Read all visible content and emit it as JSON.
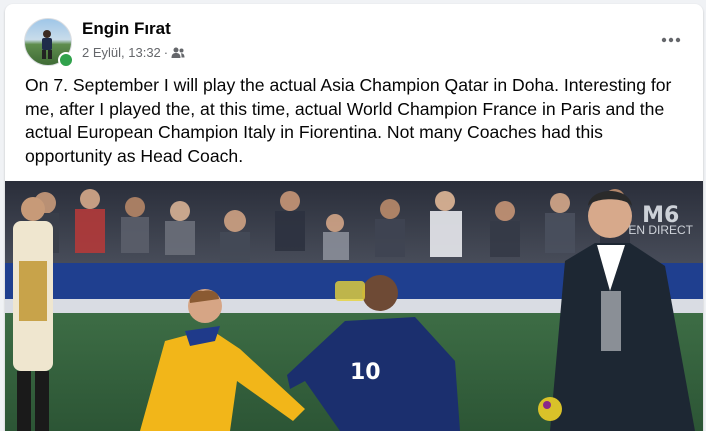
{
  "post": {
    "author": "Engin Fırat",
    "date": "2 Eylül, 13:32",
    "separator": "·",
    "text": "On 7. September I will play the actual Asia Champion Qatar in Doha. Interesting for me, after I played the, at this time, actual World Champion France in Paris and the actual European Champion Italy in Fiorentina. Not many Coaches had this opportunity as Head Coach.",
    "audience_icon": "friends-icon",
    "menu_icon": "more-options-icon"
  },
  "photo": {
    "watermark_logo": "M6",
    "watermark_label": "EN DIRECT",
    "jersey_number": "10"
  },
  "colors": {
    "online": "#31a24c",
    "meta_text": "#65676b",
    "france_blue": "#1b2f6e",
    "yellow_kit": "#f2b619"
  }
}
